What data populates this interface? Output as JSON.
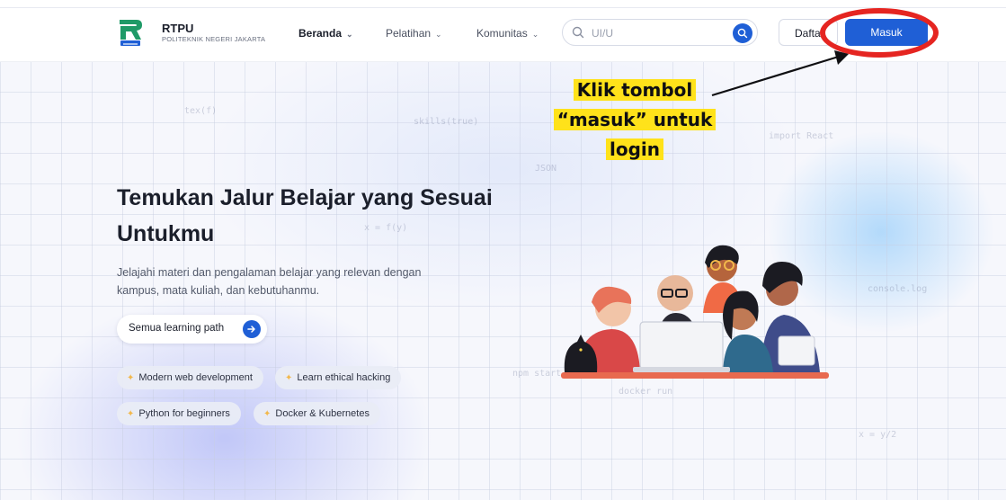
{
  "brand": {
    "name": "RTPU",
    "subtitle": "POLITEKNIK NEGERI JAKARTA",
    "logo_icon": "rtpu-logo-icon"
  },
  "nav": {
    "items": [
      {
        "label": "Beranda",
        "active": true
      },
      {
        "label": "Pelatihan",
        "active": false
      },
      {
        "label": "Komunitas",
        "active": false
      }
    ]
  },
  "search": {
    "value": "",
    "placeholder": "UI/U",
    "icon": "search-icon"
  },
  "auth": {
    "register_label": "Daftar",
    "login_label": "Masuk"
  },
  "hero": {
    "title": "Temukan Jalur Belajar yang Sesuai Untukmu",
    "description": "Jelajahi materi dan pengalaman belajar yang relevan dengan kampus, mata kuliah, dan kebutuhanmu.",
    "cta_label": "Semua learning path",
    "chips": [
      "Modern web development",
      "Learn ethical hacking",
      "Python for beginners",
      "Docker & Kubernetes"
    ]
  },
  "annotation": {
    "lines": [
      "Klik tombol",
      "“masuk” untuk",
      "login"
    ],
    "highlight_color": "#ffe21a",
    "ring_color": "#e52521"
  },
  "colors": {
    "accent": "#1f5fd6",
    "text": "#1b1f2b"
  }
}
